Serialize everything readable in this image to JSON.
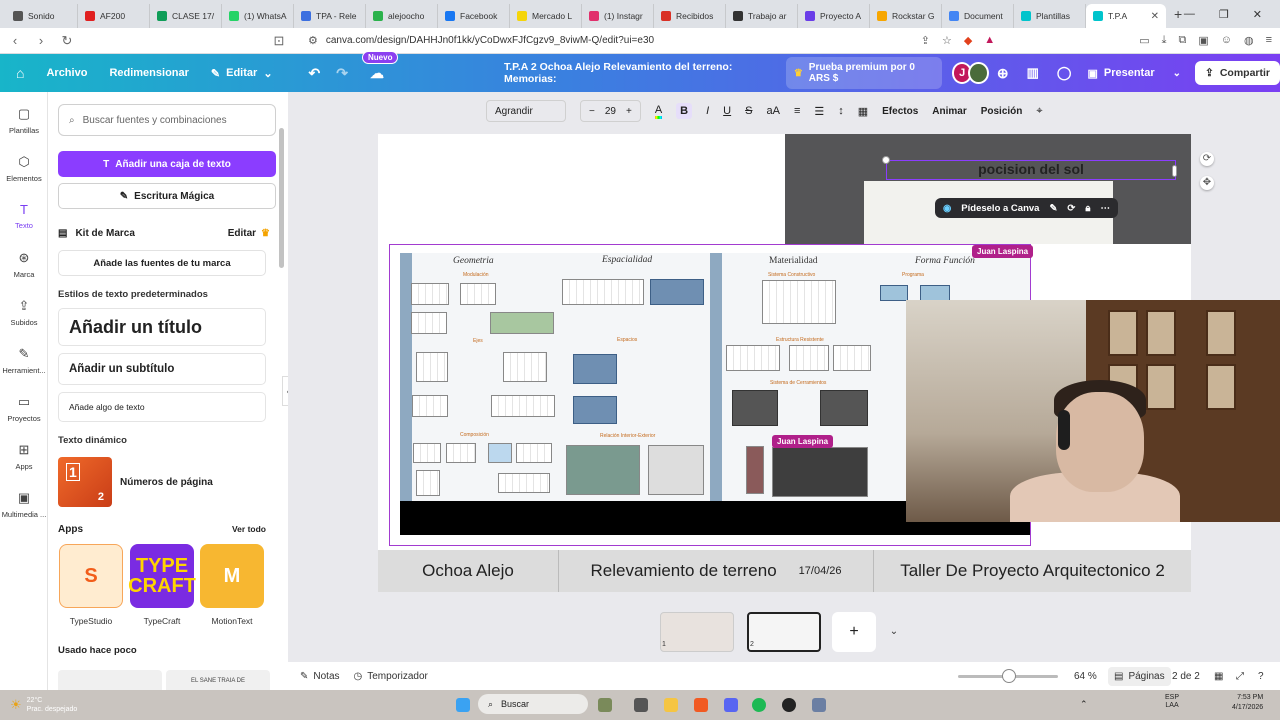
{
  "browser": {
    "tabs": [
      {
        "label": "Sonido",
        "color": "#555555"
      },
      {
        "label": "AF200",
        "color": "#e02020"
      },
      {
        "label": "CLASE 17/",
        "color": "#0f9d58"
      },
      {
        "label": "(1) WhatsA",
        "color": "#25d366"
      },
      {
        "label": "TPA - Rele",
        "color": "#3b6fe0"
      },
      {
        "label": "alejoocho",
        "color": "#2bb24c"
      },
      {
        "label": "Facebook",
        "color": "#1877f2"
      },
      {
        "label": "Mercado L",
        "color": "#f5d50a"
      },
      {
        "label": "(1) Instagr",
        "color": "#e1306c"
      },
      {
        "label": "Recibidos",
        "color": "#d93025"
      },
      {
        "label": "Trabajo ar",
        "color": "#333333"
      },
      {
        "label": "Proyecto A",
        "color": "#6a3de8"
      },
      {
        "label": "Rockstar G",
        "color": "#f7a600"
      },
      {
        "label": "Document",
        "color": "#4285f4"
      },
      {
        "label": "Plantillas",
        "color": "#00c4cc"
      },
      {
        "label": "T.P.A",
        "color": "#00c4cc",
        "active": true
      }
    ],
    "url": "canva.com/design/DAHHJn0f1kk/yCoDwxFJfCgzv9_8viwM-Q/edit?ui=e30"
  },
  "topbar": {
    "archivo": "Archivo",
    "redimensionar": "Redimensionar",
    "editar": "Editar",
    "nuevo_badge": "Nuevo",
    "doc_title": "T.P.A 2 Ochoa Alejo Relevamiento del terreno: Memorias:",
    "premium": "Prueba premium por 0 ARS $",
    "avatar_initial": "J",
    "presentar": "Presentar",
    "compartir": "Compartir"
  },
  "rail": [
    {
      "label": "Plantillas",
      "icon": "templates-icon"
    },
    {
      "label": "Elementos",
      "icon": "elements-icon"
    },
    {
      "label": "Texto",
      "icon": "text-icon",
      "active": true
    },
    {
      "label": "Marca",
      "icon": "brand-icon"
    },
    {
      "label": "Subidos",
      "icon": "uploads-icon"
    },
    {
      "label": "Herramient...",
      "icon": "tools-icon"
    },
    {
      "label": "Proyectos",
      "icon": "folder-icon"
    },
    {
      "label": "Apps",
      "icon": "apps-icon"
    },
    {
      "label": "Multimedia ...",
      "icon": "media-icon"
    }
  ],
  "panel": {
    "search_placeholder": "Buscar fuentes y combinaciones",
    "add_textbox": "Añadir una caja de texto",
    "magic_write": "Escritura Mágica",
    "brand_kit": "Kit de Marca",
    "brand_kit_edit": "Editar",
    "add_brand_fonts": "Añade las fuentes de tu marca",
    "default_styles": "Estilos de texto predeterminados",
    "add_title": "Añadir un título",
    "add_subtitle": "Añadir un subtítulo",
    "add_body": "Añade algo de texto",
    "dynamic_text": "Texto dinámico",
    "page_numbers": "Números de página",
    "page_numbers_thumb_1": "1",
    "page_numbers_thumb_2": "2",
    "apps": "Apps",
    "see_all": "Ver todo",
    "app_tiles": [
      {
        "name": "TypeStudio",
        "glyph": "S"
      },
      {
        "name": "TypeCraft",
        "glyph": "TYPE CRAFT"
      },
      {
        "name": "MotionText",
        "glyph": "M"
      }
    ],
    "recently_used": "Usado hace poco",
    "recent_thumb_2": "EL SANE TRAIA DE"
  },
  "text_toolbar": {
    "font": "Agrandir",
    "size": "29",
    "efectos": "Efectos",
    "animar": "Animar",
    "posicion": "Posición"
  },
  "canvas": {
    "sol_text": "pocision del sol",
    "ask_canva": "Pídeselo a Canva",
    "collab_tag_1": "Juan Laspina",
    "collab_tag_2": "Juan Laspina",
    "sheet_headers": [
      "Geometria",
      "Espacialidad",
      "Materialidad",
      "Forma  Función"
    ],
    "sheet_labels": [
      "Modulación",
      "Ejes",
      "Composición",
      "Espacios",
      "Relación Interior-Exterior",
      "Sistema Constructivo",
      "Estructura Resistente",
      "Sistema de Cerramientos",
      "Programa"
    ],
    "footer": {
      "name": "Ochoa Alejo",
      "subject": "Relevamiento de terreno",
      "date": "17/04/26",
      "course": "Taller De Proyecto Arquitectonico 2"
    }
  },
  "pages": {
    "thumb_1_num": "1",
    "thumb_2_num": "2"
  },
  "bottombar": {
    "notas": "Notas",
    "temporizador": "Temporizador",
    "zoom": "64 %",
    "paginas": "Páginas",
    "page_count": "2 de 2"
  },
  "taskbar": {
    "weather_temp": "22°C",
    "weather_desc": "Prac. despejado",
    "search": "Buscar",
    "lang": "ESP\nLAA",
    "time": "7:53 PM",
    "date": "4/17/2026"
  }
}
